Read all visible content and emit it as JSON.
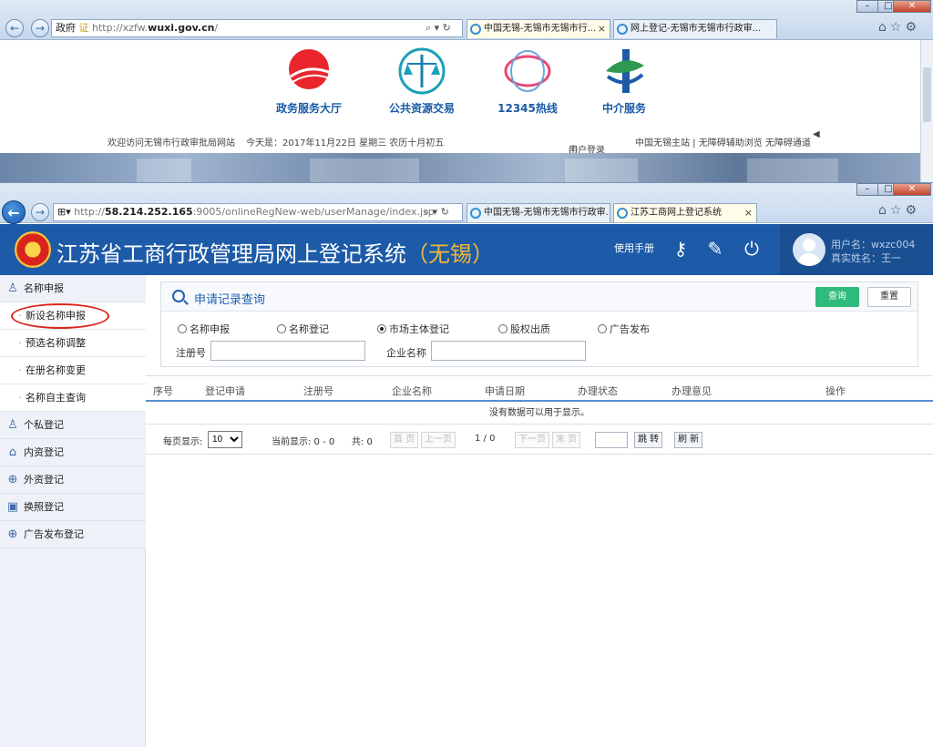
{
  "back_window": {
    "address_prefix": "政府",
    "address_cert": "证",
    "address_url_pre": "http://xzfw.",
    "address_url_main": "wuxi.gov.cn",
    "address_url_post": "/",
    "tabs": [
      {
        "label": "中国无锡-无锡市无锡市行..."
      },
      {
        "label": "网上登记-无锡市无锡市行政审..."
      }
    ],
    "services": [
      {
        "label": "政务服务大厅",
        "icon": "service-hall-icon"
      },
      {
        "label": "公共资源交易",
        "icon": "scales-icon"
      },
      {
        "label": "12345热线",
        "icon": "hotline-12345-icon"
      },
      {
        "label": "中介服务",
        "icon": "agency-icon"
      }
    ],
    "welcome_text": "欢迎访问无锡市行政审批局网站",
    "date_text": "今天是：2017年11月22日 星期三 农历十月初五",
    "user_login": "用户登录",
    "links": "中国无锡主站 | 无障碍辅助浏览 无障碍通道"
  },
  "front_window": {
    "address_pre": "http://",
    "address_host": "58.214.252.165",
    "address_rest": ":9005/onlineRegNew-web/userManage/index.jsp",
    "tabs": [
      {
        "label": "中国无锡-无锡市无锡市行政审...",
        "active": false
      },
      {
        "label": "江苏工商网上登记系统",
        "active": true
      }
    ]
  },
  "app": {
    "title": "江苏省工商行政管理局网上登记系统",
    "city": "（无锡）",
    "manual_link": "使用手册",
    "user_name_line": "用户名：wxzc004",
    "real_name_line": "真实姓名：王一",
    "header_color": "#1d5ba8"
  },
  "sidebar": {
    "groups": [
      {
        "label": "名称申报",
        "icon": "user-icon",
        "items": [
          {
            "label": "新设名称申报",
            "highlighted": true
          },
          {
            "label": "预选名称调整"
          },
          {
            "label": "在册名称变更"
          },
          {
            "label": "名称自主查询"
          }
        ]
      },
      {
        "label": "个私登记",
        "icon": "user-icon"
      },
      {
        "label": "内资登记",
        "icon": "building-icon"
      },
      {
        "label": "外资登记",
        "icon": "globe-icon"
      },
      {
        "label": "换照登记",
        "icon": "license-icon"
      },
      {
        "label": "广告发布登记",
        "icon": "globe-icon"
      }
    ]
  },
  "query_panel": {
    "title": "申请记录查询",
    "query_button": "查询",
    "reset_button": "重置",
    "radios": [
      {
        "label": "名称申报",
        "checked": false
      },
      {
        "label": "名称登记",
        "checked": false
      },
      {
        "label": "市场主体登记",
        "checked": true
      },
      {
        "label": "股权出质",
        "checked": false
      },
      {
        "label": "广告发布",
        "checked": false
      }
    ],
    "reg_no_label": "注册号",
    "reg_no_value": "",
    "company_label": "企业名称",
    "company_value": ""
  },
  "grid": {
    "columns": [
      "序号",
      "登记申请",
      "注册号",
      "企业名称",
      "申请日期",
      "办理状态",
      "办理意见",
      "操作"
    ],
    "rows": [],
    "empty_text": "没有数据可以用于显示。"
  },
  "pager": {
    "per_page_label": "每页显示:",
    "per_page_value": "10",
    "current_display": "当前显示: 0 - 0",
    "total": "共: 0",
    "first": "首 页",
    "prev": "上一页",
    "page_info": "1 / 0",
    "next": "下一页",
    "last": "末 页",
    "jump": "跳 转",
    "refresh": "刷 新"
  }
}
